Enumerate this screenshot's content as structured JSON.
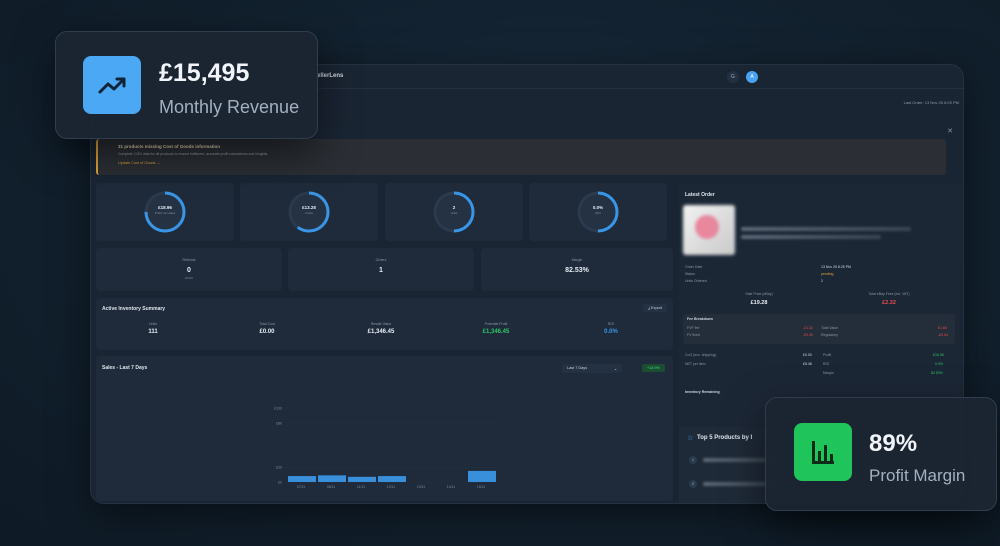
{
  "app": {
    "brand": "ellerLens",
    "user_initial": "A",
    "top_icon": "G"
  },
  "header": {
    "last_order": "Last Order: 13 Nov 25 8:25 PM"
  },
  "alert": {
    "title": "31 products missing Cost of Goods information",
    "subtitle": "Complete COG data for all products to ensure fulfilment, accurate profit calculations and insights.",
    "link": "Update Cost of Goods →"
  },
  "rings": [
    {
      "value": "£18.96",
      "caption": "Prefix net sales",
      "progress": 0.75,
      "color": "#3a95e6"
    },
    {
      "value": "£13.28",
      "caption": "Costs",
      "progress": 0.6,
      "color": "#3a95e6"
    },
    {
      "value": "2",
      "caption": "Units",
      "progress": 0.5,
      "color": "#3a95e6"
    },
    {
      "value": "0.0%",
      "caption": "ROI",
      "progress": 0.5,
      "color": "#3a95e6"
    }
  ],
  "stats": [
    {
      "label": "Refunds",
      "value": "0",
      "sub": "£0.00"
    },
    {
      "label": "Orders",
      "value": "1",
      "sub": ""
    },
    {
      "label": "Margin",
      "value": "82.53%",
      "sub": ""
    }
  ],
  "inventory": {
    "title": "Active Inventory Summary",
    "export": "Export",
    "cols": [
      {
        "k": "Units",
        "v": "111",
        "color": "#e6edf4"
      },
      {
        "k": "Total Cost",
        "v": "£0.00",
        "color": "#e6edf4"
      },
      {
        "k": "Resale Value",
        "v": "£1,346.45",
        "color": "#e6edf4"
      },
      {
        "k": "Potential Profit",
        "v": "£1,346.45",
        "color": "#2ec566"
      },
      {
        "k": "ROI",
        "v": "0.0%",
        "color": "#3a95e6"
      }
    ]
  },
  "sales": {
    "title": "Sales - Last 7 Days",
    "range": "Last 7 Days",
    "badge": "+18.9%",
    "yticks": [
      "£100",
      "£80",
      "£20",
      "£0"
    ],
    "xticks": [
      "07/11",
      "08/11",
      "11/11",
      "12/11",
      "13/11",
      "14/11",
      "15/11"
    ]
  },
  "chart_data": {
    "type": "bar",
    "title": "Sales - Last 7 Days",
    "categories": [
      "07/11",
      "08/11",
      "11/11",
      "12/11",
      "13/11",
      "14/11",
      "15/11"
    ],
    "values": [
      8,
      9,
      7,
      8,
      0,
      0,
      15
    ],
    "ylim": [
      0,
      100
    ]
  },
  "latest_order": {
    "title": "Latest Order",
    "rows": [
      {
        "k": "Order Date",
        "v": "13 Nov 25 8:25 PM"
      },
      {
        "k": "Status",
        "v": "pending"
      },
      {
        "k": "Units Ordered",
        "v": "2"
      }
    ],
    "sale_price_label": "Sale Price (eBay)",
    "sale_price": "£19.28",
    "fees_label": "Total eBay Fees (inc. VAT)",
    "fees": "£2.32",
    "fee_breakdown_title": "Fee Breakdown",
    "fee_rows": [
      {
        "k": "FVF fee",
        "v": "-£1.32",
        "k2": "Total Value",
        "v2": "£1.66"
      },
      {
        "k": "FV fixed",
        "v": "-£0.40",
        "k2": "Regulatory",
        "v2": "-£0.04"
      }
    ],
    "cost_rows": [
      {
        "k": "CoG (exc. shipping)",
        "v": "£0.00",
        "k2": "Profit",
        "v2": "£16.96"
      },
      {
        "k": "NET per item",
        "v": "£8.48",
        "k2": "ROI",
        "v2": "0.0%"
      },
      {
        "k": "",
        "v": "",
        "k2": "Margin",
        "v2": "82.53%"
      }
    ],
    "inventory_remaining": "Inventory Remaining"
  },
  "top_products": {
    "title": "Top 5 Products by I",
    "rank1": "1",
    "rank2": "2"
  },
  "float_revenue": {
    "value": "£15,495",
    "caption": "Monthly Revenue",
    "icon": "trending-up-icon",
    "color": "#4aa8f5"
  },
  "float_margin": {
    "value": "89%",
    "caption": "Profit Margin",
    "icon": "bar-chart-icon",
    "color": "#1fc45a"
  }
}
